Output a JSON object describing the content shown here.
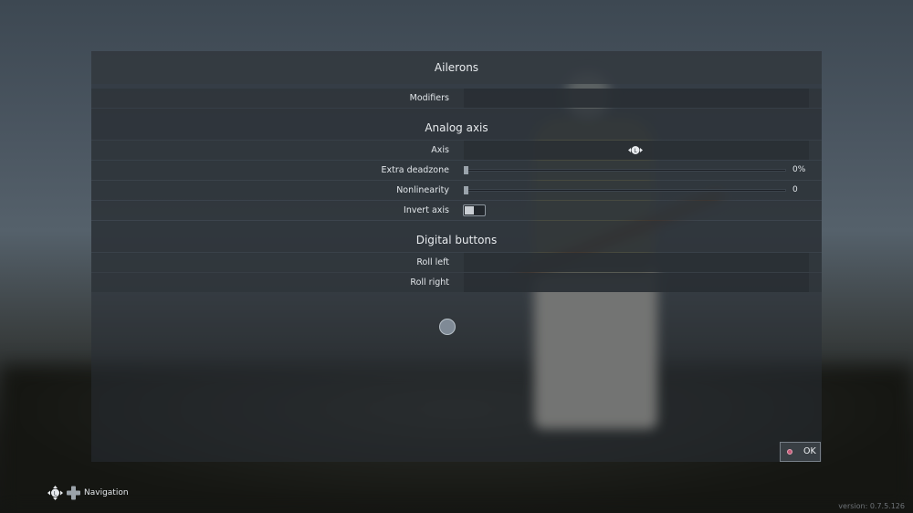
{
  "dialog": {
    "title": "Ailerons",
    "modifiers_label": "Modifiers"
  },
  "analog": {
    "heading": "Analog axis",
    "axis_label": "Axis",
    "axis_icon": "left-stick-horizontal-icon",
    "deadzone_label": "Extra deadzone",
    "deadzone_value": "0%",
    "deadzone_fraction": 0,
    "nonlinearity_label": "Nonlinearity",
    "nonlinearity_value": "0",
    "nonlinearity_fraction": 0,
    "invert_label": "Invert axis",
    "invert_on": false
  },
  "digital": {
    "heading": "Digital buttons",
    "roll_left_label": "Roll left",
    "roll_right_label": "Roll right"
  },
  "footer": {
    "ok_label": "OK",
    "ok_icon": "gamepad-b-button-icon",
    "nav_label": "Navigation",
    "nav_icons": [
      "left-stick-icon",
      "dpad-icon"
    ],
    "version": "version: 0.7.5.126"
  },
  "colors": {
    "panel": "#2e343a",
    "accent_dot": "#c65a78"
  }
}
